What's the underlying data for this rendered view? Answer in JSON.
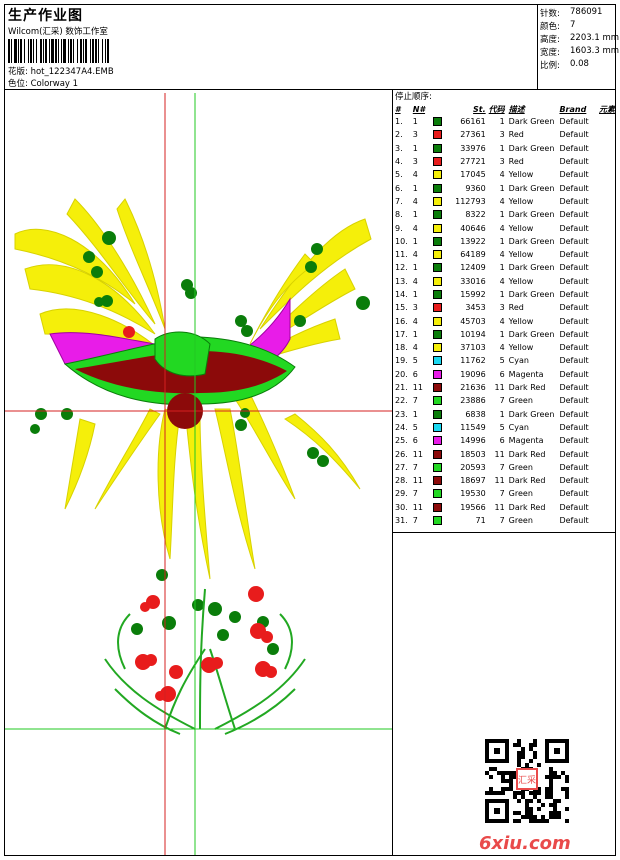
{
  "header": {
    "title": "生产作业图",
    "company": "Wilcom(汇采) 数饰工作室",
    "design_label": "花版:",
    "design_value": "hot_122347A4.EMB",
    "colorway_label": "色位:",
    "colorway_value": "Colorway 1"
  },
  "stats": [
    {
      "label": "针数:",
      "value": "786091"
    },
    {
      "label": "颜色:",
      "value": "7"
    },
    {
      "label": "高度:",
      "value": "2203.1 mm"
    },
    {
      "label": "宽度:",
      "value": "1603.3 mm"
    },
    {
      "label": "比例:",
      "value": "0.08"
    }
  ],
  "stop_sequence": {
    "title": "停止顺序:",
    "headers": {
      "idx": "#",
      "n": "N#",
      "st": "St.",
      "code": "代码",
      "desc": "描述",
      "brand": "Brand",
      "elem": "元素"
    },
    "rows": [
      {
        "idx": "1.",
        "n": "1",
        "color": "#0a7d0a",
        "st": "66161",
        "code": "1",
        "desc": "Dark Green",
        "brand": "Default"
      },
      {
        "idx": "2.",
        "n": "3",
        "color": "#e81c1c",
        "st": "27361",
        "code": "3",
        "desc": "Red",
        "brand": "Default"
      },
      {
        "idx": "3.",
        "n": "1",
        "color": "#0a7d0a",
        "st": "33976",
        "code": "1",
        "desc": "Dark Green",
        "brand": "Default"
      },
      {
        "idx": "4.",
        "n": "3",
        "color": "#e81c1c",
        "st": "27721",
        "code": "3",
        "desc": "Red",
        "brand": "Default"
      },
      {
        "idx": "5.",
        "n": "4",
        "color": "#f5ef0a",
        "st": "17045",
        "code": "4",
        "desc": "Yellow",
        "brand": "Default"
      },
      {
        "idx": "6.",
        "n": "1",
        "color": "#0a7d0a",
        "st": "9360",
        "code": "1",
        "desc": "Dark Green",
        "brand": "Default"
      },
      {
        "idx": "7.",
        "n": "4",
        "color": "#f5ef0a",
        "st": "112793",
        "code": "4",
        "desc": "Yellow",
        "brand": "Default"
      },
      {
        "idx": "8.",
        "n": "1",
        "color": "#0a7d0a",
        "st": "8322",
        "code": "1",
        "desc": "Dark Green",
        "brand": "Default"
      },
      {
        "idx": "9.",
        "n": "4",
        "color": "#f5ef0a",
        "st": "40646",
        "code": "4",
        "desc": "Yellow",
        "brand": "Default"
      },
      {
        "idx": "10.",
        "n": "1",
        "color": "#0a7d0a",
        "st": "13922",
        "code": "1",
        "desc": "Dark Green",
        "brand": "Default"
      },
      {
        "idx": "11.",
        "n": "4",
        "color": "#f5ef0a",
        "st": "64189",
        "code": "4",
        "desc": "Yellow",
        "brand": "Default"
      },
      {
        "idx": "12.",
        "n": "1",
        "color": "#0a7d0a",
        "st": "12409",
        "code": "1",
        "desc": "Dark Green",
        "brand": "Default"
      },
      {
        "idx": "13.",
        "n": "4",
        "color": "#f5ef0a",
        "st": "33016",
        "code": "4",
        "desc": "Yellow",
        "brand": "Default"
      },
      {
        "idx": "14.",
        "n": "1",
        "color": "#0a7d0a",
        "st": "15992",
        "code": "1",
        "desc": "Dark Green",
        "brand": "Default"
      },
      {
        "idx": "15.",
        "n": "3",
        "color": "#e81c1c",
        "st": "3453",
        "code": "3",
        "desc": "Red",
        "brand": "Default"
      },
      {
        "idx": "16.",
        "n": "4",
        "color": "#f5ef0a",
        "st": "45703",
        "code": "4",
        "desc": "Yellow",
        "brand": "Default"
      },
      {
        "idx": "17.",
        "n": "1",
        "color": "#0a7d0a",
        "st": "10194",
        "code": "1",
        "desc": "Dark Green",
        "brand": "Default"
      },
      {
        "idx": "18.",
        "n": "4",
        "color": "#f5ef0a",
        "st": "37103",
        "code": "4",
        "desc": "Yellow",
        "brand": "Default"
      },
      {
        "idx": "19.",
        "n": "5",
        "color": "#1ad8f0",
        "st": "11762",
        "code": "5",
        "desc": "Cyan",
        "brand": "Default"
      },
      {
        "idx": "20.",
        "n": "6",
        "color": "#e81ce8",
        "st": "19096",
        "code": "6",
        "desc": "Magenta",
        "brand": "Default"
      },
      {
        "idx": "21.",
        "n": "11",
        "color": "#8c0a0a",
        "st": "21636",
        "code": "11",
        "desc": "Dark Red",
        "brand": "Default"
      },
      {
        "idx": "22.",
        "n": "7",
        "color": "#22d822",
        "st": "23886",
        "code": "7",
        "desc": "Green",
        "brand": "Default"
      },
      {
        "idx": "23.",
        "n": "1",
        "color": "#0a7d0a",
        "st": "6838",
        "code": "1",
        "desc": "Dark Green",
        "brand": "Default"
      },
      {
        "idx": "24.",
        "n": "5",
        "color": "#1ad8f0",
        "st": "11549",
        "code": "5",
        "desc": "Cyan",
        "brand": "Default"
      },
      {
        "idx": "25.",
        "n": "6",
        "color": "#e81ce8",
        "st": "14996",
        "code": "6",
        "desc": "Magenta",
        "brand": "Default"
      },
      {
        "idx": "26.",
        "n": "11",
        "color": "#8c0a0a",
        "st": "18503",
        "code": "11",
        "desc": "Dark Red",
        "brand": "Default"
      },
      {
        "idx": "27.",
        "n": "7",
        "color": "#22d822",
        "st": "20593",
        "code": "7",
        "desc": "Green",
        "brand": "Default"
      },
      {
        "idx": "28.",
        "n": "11",
        "color": "#8c0a0a",
        "st": "18697",
        "code": "11",
        "desc": "Dark Red",
        "brand": "Default"
      },
      {
        "idx": "29.",
        "n": "7",
        "color": "#22d822",
        "st": "19530",
        "code": "7",
        "desc": "Green",
        "brand": "Default"
      },
      {
        "idx": "30.",
        "n": "11",
        "color": "#8c0a0a",
        "st": "19566",
        "code": "11",
        "desc": "Dark Red",
        "brand": "Default"
      },
      {
        "idx": "31.",
        "n": "7",
        "color": "#22d822",
        "st": "71",
        "code": "7",
        "desc": "Green",
        "brand": "Default"
      }
    ]
  },
  "watermark": "6xiu.com",
  "qr_seal_text": "汇采",
  "colors": {
    "crosshair_red": "#d42020",
    "crosshair_green": "#22c822"
  }
}
